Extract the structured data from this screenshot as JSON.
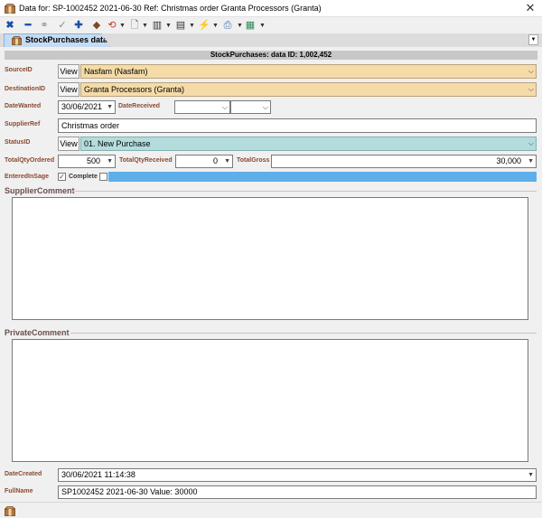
{
  "window": {
    "title": "Data for: SP-1002452 2021-06-30 Ref: Christmas order Granta Processors (Granta)"
  },
  "colors": {
    "label": "#8a4a2f",
    "source_bg": "#f5dba8",
    "status_bg": "#b5dcdc",
    "accent_bar": "#5eaeea",
    "tab_bg": "#c5dbf2"
  },
  "tab": {
    "label": "StockPurchases data"
  },
  "header": {
    "text": "StockPurchases: data ID: 1,002,452"
  },
  "fields": {
    "source": {
      "label": "SourceID",
      "view": "View",
      "value": "Nasfam (Nasfam)"
    },
    "destination": {
      "label": "DestinationID",
      "view": "View",
      "value": "Granta Processors (Granta)"
    },
    "date_wanted": {
      "label": "DateWanted",
      "value": "30/06/2021"
    },
    "date_received": {
      "label": "DateReceived",
      "value": ""
    },
    "supplier_ref": {
      "label": "SupplierRef",
      "value": "Christmas order"
    },
    "status": {
      "label": "StatusID",
      "view": "View",
      "value": "01. New Purchase"
    },
    "total_qty_ordered": {
      "label": "TotalQtyOrdered",
      "value": "500"
    },
    "total_qty_received": {
      "label": "TotalQtyReceived",
      "value": "0"
    },
    "total_gross": {
      "label": "TotalGross",
      "value": "30,000"
    },
    "entered_in_sage": {
      "label": "EnteredInSage",
      "checked": true
    },
    "complete": {
      "label": "Complete",
      "checked": false
    },
    "supplier_comment": {
      "label": "SupplierComment",
      "value": ""
    },
    "private_comment": {
      "label": "PrivateComment",
      "value": ""
    },
    "date_created": {
      "label": "DateCreated",
      "value": "30/06/2021 11:14:38"
    },
    "full_name": {
      "label": "FullName",
      "value": "SP1002452 2021-06-30 Value: 30000"
    }
  },
  "icons": [
    "app-box-icon",
    "cancel-x-icon",
    "minus-icon",
    "link-icon",
    "check-icon",
    "plus-icon",
    "eraser-icon",
    "refresh-icon",
    "document-icon",
    "columns-icon",
    "form-icon",
    "lightning-icon",
    "print-icon",
    "chart-icon"
  ]
}
